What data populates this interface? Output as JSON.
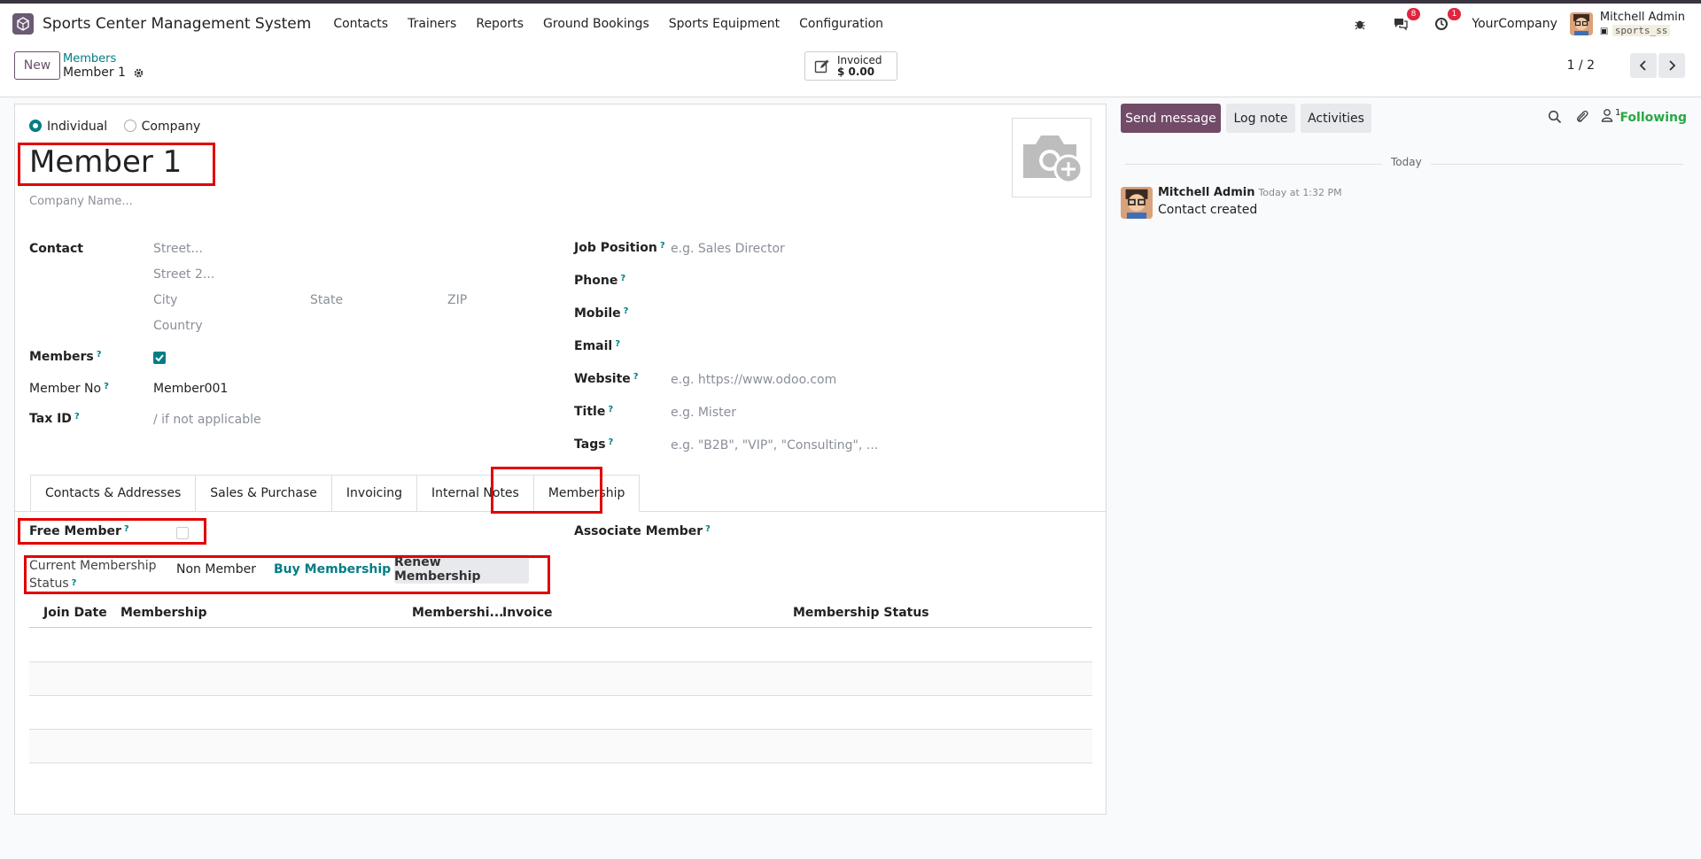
{
  "navbar": {
    "app_name": "Sports Center Management System",
    "menu": [
      "Contacts",
      "Trainers",
      "Reports",
      "Ground Bookings",
      "Sports Equipment",
      "Configuration"
    ],
    "chat_badge": "8",
    "activity_badge": "1",
    "company": "YourCompany",
    "user_name": "Mitchell Admin",
    "db_name": "sports_ss"
  },
  "control": {
    "new_label": "New",
    "breadcrumb_parent": "Members",
    "breadcrumb_current": "Member 1",
    "smart_button_title": "Invoiced",
    "smart_button_value": "$ 0.00",
    "pager": "1 / 2"
  },
  "form": {
    "type_individual": "Individual",
    "type_company": "Company",
    "name": "Member 1",
    "company_placeholder": "Company Name...",
    "contact_label": "Contact",
    "street_placeholder": "Street...",
    "street2_placeholder": "Street 2...",
    "city_placeholder": "City",
    "state_placeholder": "State",
    "zip_placeholder": "ZIP",
    "country_placeholder": "Country",
    "members_label": "Members",
    "member_no_label": "Member No",
    "member_no_value": "Member001",
    "tax_id_label": "Tax ID",
    "tax_id_placeholder": "/ if not applicable",
    "job_position_label": "Job Position",
    "job_position_placeholder": "e.g. Sales Director",
    "phone_label": "Phone",
    "mobile_label": "Mobile",
    "email_label": "Email",
    "website_label": "Website",
    "website_placeholder": "e.g. https://www.odoo.com",
    "title_label": "Title",
    "title_placeholder": "e.g. Mister",
    "tags_label": "Tags",
    "tags_placeholder": "e.g. \"B2B\", \"VIP\", \"Consulting\", ...",
    "help_mark": "?"
  },
  "tabs": [
    "Contacts & Addresses",
    "Sales & Purchase",
    "Invoicing",
    "Internal Notes",
    "Membership"
  ],
  "membership": {
    "free_member_label": "Free Member",
    "associate_member_label": "Associate Member",
    "status_label_line1": "Current Membership",
    "status_label_line2": "Status",
    "status_value": "Non Member",
    "buy_label": "Buy Membership",
    "renew_label": "Renew Membership",
    "columns": [
      "Join Date",
      "Membership",
      "Membershi...",
      "Invoice",
      "Membership Status"
    ]
  },
  "chatter": {
    "send_message": "Send message",
    "log_note": "Log note",
    "activities": "Activities",
    "follower_count": "1",
    "following": "Following",
    "today": "Today",
    "author": "Mitchell Admin",
    "time": "Today at 1:32 PM",
    "body": "Contact created"
  },
  "colors": {
    "brand": "#714b67",
    "accent": "#017e84",
    "highlight": "#e00000"
  }
}
